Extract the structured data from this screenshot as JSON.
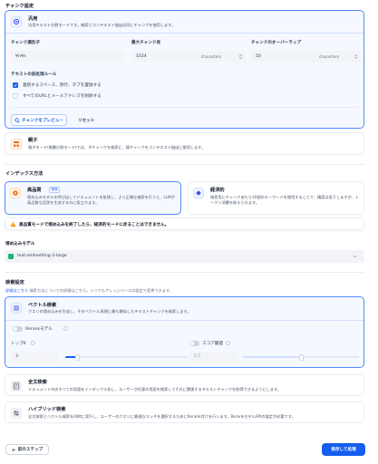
{
  "chunk": {
    "section_title": "チャンク設定",
    "general": {
      "title": "汎用",
      "desc": "汎用テキスト分割モードです。検索とコンテキスト抽出は同じチャンクを使用します。",
      "separator_label": "チャンク識別子",
      "separator_value": "¥n¥n",
      "max_len_label": "最大チャンク長",
      "max_len_value": "1024",
      "max_len_unit": "characters",
      "overlap_label": "チャンクのオーバーラップ",
      "overlap_value": "50",
      "overlap_unit": "characters",
      "preprocess_label": "テキストの前処理ルール",
      "rule1": "連続するスペース、改行、タブを置換する",
      "rule2": "すべてのURLとメールアドレスを削除する",
      "preview_btn": "チャンクをプレビュー",
      "reset_btn": "リセット"
    },
    "parent_child": {
      "title": "親子",
      "desc": "親子モード(階層分割モード)では、子チャンクを検索に、親チャンクをコンテキスト抽出に使用します。"
    }
  },
  "index": {
    "section_title": "インデックス方法",
    "high": {
      "title": "高品質",
      "badge": "推奨",
      "desc": "埋め込みモデルを呼び出してドキュメントを処理し、より正確な検索を行うと、LLMが高品質な回答を生成するのに役立ちます。"
    },
    "economy": {
      "title": "経済的",
      "desc": "検索用にチャンクあたり10個のキーワードを使用することで、精度は低下しますが、トークン消費を抑えられます。"
    },
    "warning": "高品質モードで埋め込みを終了したら、経済的モードに戻ることはできません。"
  },
  "embedding": {
    "label": "埋め込みモデル",
    "value": "text-embedding-3-large"
  },
  "retrieval": {
    "section_title": "検索設定",
    "link_text": "詳細はこちら",
    "subtitle": " 検索方法についての詳細はこちら。いつでもナレッジベースの設定で変更できます。",
    "vector": {
      "title": "ベクトル検索",
      "desc": "クエリの埋め込みを生成し、そのベクトル表現に最も類似したテキストチャンクを検索します。",
      "rerank_label": "Rerankモデル",
      "topk_label": "トップK",
      "topk_value": "3",
      "topk_fraction": 0.1,
      "score_label": "スコア閾値",
      "score_value": "0.5",
      "score_fraction": 0.5
    },
    "fulltext": {
      "title": "全文検索",
      "desc": "ドキュメント内のすべての用語をインデックス化し、ユーザーが任意の用語を検索してそれに関連するテキストチャンクを取得できるようにします。"
    },
    "hybrid": {
      "title": "ハイブリッド検索",
      "desc": "全文検索とベクトル検索を同時に実行し、ユーザーのクエリに最適なマッチを選択するためにRerank付けを行います。RerankモデルAPIの設定が必要です。"
    }
  },
  "footer": {
    "back": "前のステップ",
    "save": "保存して処理"
  },
  "colors": {
    "primary": "#155eef",
    "selected_border": "#528bff",
    "warning": "#f79009"
  }
}
